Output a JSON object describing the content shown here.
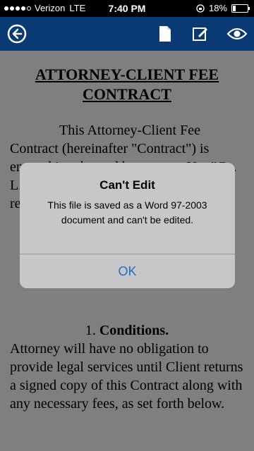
{
  "status_bar": {
    "carrier": "Verizon",
    "network": "LTE",
    "time": "7:40 PM",
    "battery": "18%",
    "battery_level": 0.18
  },
  "toolbar": {
    "back_icon": "back-arrow-circle-icon",
    "doc_icon": "document-icon",
    "edit_icon": "edit-icon",
    "view_icon": "eye-icon",
    "color": "#0a3a73"
  },
  "document": {
    "title": "ATTORNEY-CLIENT FEE CONTRACT",
    "paragraph": "This Attorney-Client Fee Contract (hereinafter \"Contract\") is entered into by and between ... N... \"C... L... \"A... fo... be... Attorney-Client relationship.",
    "section_number": "1.",
    "section_title": "Conditions.",
    "section_body": "Attorney will have no obligation to provide legal services until Client returns a signed copy of this Contract along with any necessary fees, as set forth below."
  },
  "alert": {
    "title": "Can't Edit",
    "message": "This file is saved as a Word 97-2003 document and can't be edited.",
    "ok_label": "OK"
  }
}
